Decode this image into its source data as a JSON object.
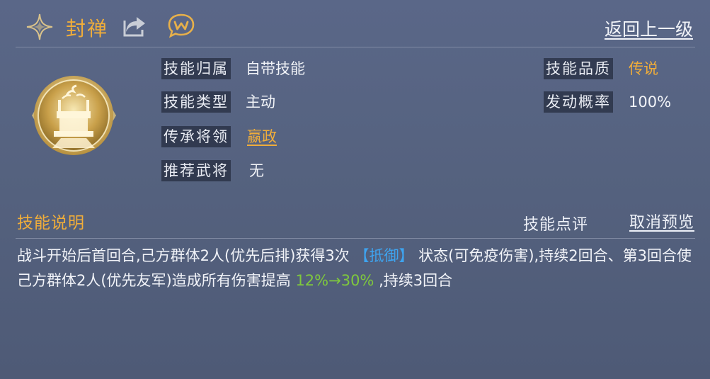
{
  "header": {
    "skill_name": "封禅",
    "back_label": "返回上一级"
  },
  "info": {
    "belong_label": "技能归属",
    "belong_value": "自带技能",
    "type_label": "技能类型",
    "type_value": "主动",
    "inherit_label": "传承将领",
    "inherit_value": "嬴政",
    "recommend_label": "推荐武将",
    "recommend_value": "无",
    "quality_label": "技能品质",
    "quality_value": "传说",
    "chance_label": "发动概率",
    "chance_value": "100%"
  },
  "description": {
    "section_title": "技能说明",
    "comment_label": "技能点评",
    "cancel_preview_label": "取消预览",
    "text_part1": "战斗开始后首回合,己方群体2人(优先后排)获得3次",
    "keyword": "【抵御】",
    "text_part2": "状态(可免疫伤害),持续2回合、第3回合使己方群体2人(优先友军)造成所有伤害提高",
    "highlight": "12%→30%",
    "text_part3": ",持续3回合"
  },
  "colors": {
    "accent_orange": "#f0ad3a",
    "keyword_blue": "#3ea4f0",
    "highlight_green": "#7fc83d"
  },
  "icons": [
    "sparkle-icon",
    "share-icon",
    "w-chat-icon",
    "skill-emblem-icon"
  ]
}
